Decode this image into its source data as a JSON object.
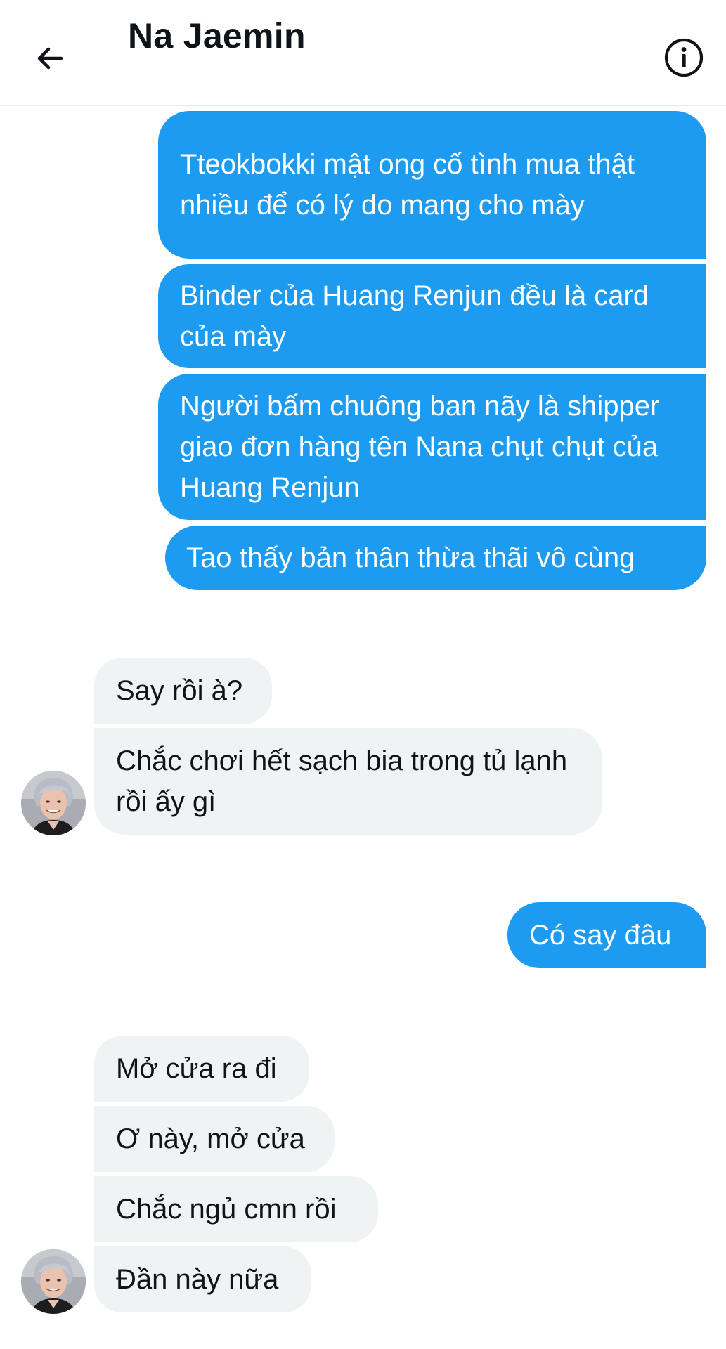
{
  "header": {
    "title": "Na Jaemin",
    "back_icon": "arrow-left-icon",
    "info_icon": "info-circle-icon"
  },
  "messages": {
    "sent1": {
      "text": "Tteokbokki mật ong cố tình mua thật nhiều để có lý do mang cho mày"
    },
    "sent2": {
      "text": "Binder của Huang Renjun đều là card của mày"
    },
    "sent3": {
      "text": "Người bấm chuông ban nãy là shipper giao đơn hàng tên Nana chụt chụt của Huang Renjun"
    },
    "sent4": {
      "text": "Tao thấy bản thân thừa thãi vô cùng"
    },
    "recv1": {
      "text": "Say rồi à?"
    },
    "recv2": {
      "text": "Chắc chơi hết sạch bia trong tủ lạnh rồi ấy gì"
    },
    "sent5": {
      "text": "Có say đâu"
    },
    "recv3": {
      "text": "Mở cửa ra đi"
    },
    "recv4": {
      "text": "Ơ này, mở cửa"
    },
    "recv5": {
      "text": "Chắc ngủ cmn rồi"
    },
    "recv6": {
      "text": "Đần này nữa"
    }
  },
  "colors": {
    "sent_bubble": "#1d9bf0",
    "received_bubble": "#eff3f4",
    "text_primary": "#0f1419"
  }
}
